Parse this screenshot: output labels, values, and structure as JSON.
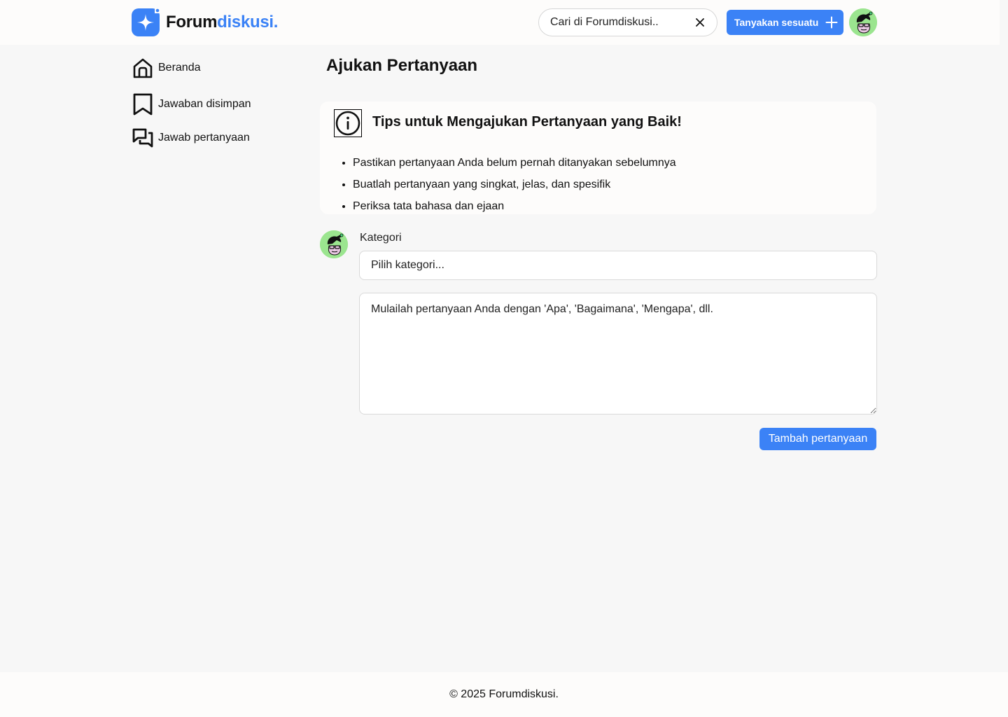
{
  "header": {
    "logo": {
      "part1": "Forum",
      "part2": "diskusi."
    },
    "search": {
      "value": "Cari di Forumdiskusi..",
      "clear_icon": "close-icon"
    },
    "ask_button": {
      "label": "Tanyakan sesuatu",
      "icon": "plus-icon"
    },
    "avatar_icon": "user-avatar"
  },
  "sidebar": {
    "items": [
      {
        "label": "Beranda",
        "icon": "home-icon"
      },
      {
        "label": "Jawaban disimpan",
        "icon": "bookmark-icon"
      },
      {
        "label": "Jawab pertanyaan",
        "icon": "chat-icon"
      }
    ]
  },
  "main": {
    "title": "Ajukan Pertanyaan",
    "tips": {
      "title": "Tips untuk Mengajukan Pertanyaan yang Baik!",
      "icon": "info-icon",
      "items": [
        "Pastikan pertanyaan Anda belum pernah ditanyakan sebelumnya",
        "Buatlah pertanyaan yang singkat, jelas, dan spesifik",
        "Periksa tata bahasa dan ejaan"
      ]
    },
    "form": {
      "category_label": "Kategori",
      "category_placeholder": "Pilih kategori...",
      "question_placeholder": "Mulailah pertanyaan Anda dengan 'Apa', 'Bagaimana', 'Mengapa', dll.",
      "submit_label": "Tambah pertanyaan"
    }
  },
  "footer": {
    "text": "© 2025 Forumdiskusi."
  },
  "colors": {
    "accent": "#3b82f6",
    "avatar_bg": "#9be58f",
    "page_bg": "#f7f7f7",
    "surface": "#fdfcfb"
  }
}
